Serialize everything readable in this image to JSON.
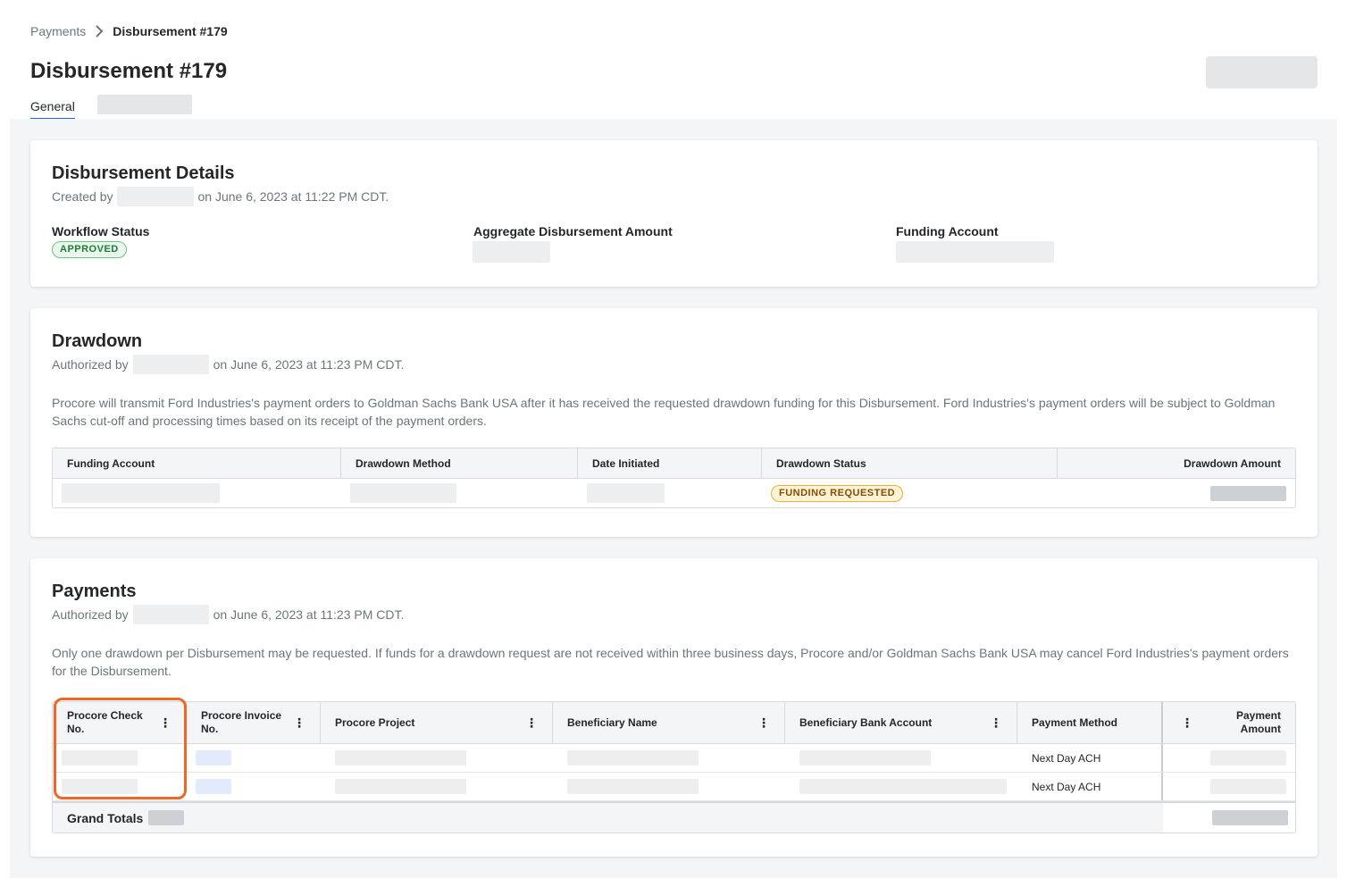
{
  "breadcrumb": {
    "parent": "Payments",
    "current": "Disbursement #179"
  },
  "page": {
    "title": "Disbursement #179"
  },
  "tabs": [
    {
      "label": "General",
      "active": true
    }
  ],
  "details": {
    "title": "Disbursement Details",
    "created_prefix": "Created by",
    "created_suffix": "on June 6, 2023 at 11:22 PM CDT.",
    "workflow_label": "Workflow Status",
    "workflow_status": "APPROVED",
    "aggregate_label": "Aggregate Disbursement Amount",
    "funding_label": "Funding Account"
  },
  "drawdown": {
    "title": "Drawdown",
    "authorized_prefix": "Authorized by",
    "authorized_suffix": "on June 6, 2023 at 11:23 PM CDT.",
    "description": "Procore will transmit Ford Industries's payment orders to Goldman Sachs Bank USA after it has received the requested drawdown funding for this Disbursement. Ford Industries's payment orders will be subject to Goldman Sachs cut-off and processing times based on its receipt of the payment orders.",
    "columns": [
      "Funding Account",
      "Drawdown Method",
      "Date Initiated",
      "Drawdown Status",
      "Drawdown Amount"
    ],
    "row_status": "FUNDING REQUESTED"
  },
  "payments": {
    "title": "Payments",
    "authorized_prefix": "Authorized by",
    "authorized_suffix": "on June 6, 2023 at 11:23 PM CDT.",
    "description": "Only one drawdown per Disbursement may be requested. If funds for a drawdown request are not received within three business days, Procore and/or Goldman Sachs Bank USA may cancel Ford Industries's payment orders for the Disbursement.",
    "columns": {
      "check_no": "Procore Check No.",
      "invoice_no": "Procore Invoice No.",
      "project": "Procore Project",
      "beneficiary_name": "Beneficiary Name",
      "bank_account": "Beneficiary Bank Account",
      "payment_method": "Payment Method",
      "payment_amount": "Payment Amount"
    },
    "rows": [
      {
        "payment_method": "Next Day ACH"
      },
      {
        "payment_method": "Next Day ACH"
      }
    ],
    "grand_totals_label": "Grand Totals"
  },
  "colors": {
    "accent": "#2066df",
    "highlight": "#f26522",
    "approved": "#1e7e34",
    "requested": "#8a4b00"
  }
}
